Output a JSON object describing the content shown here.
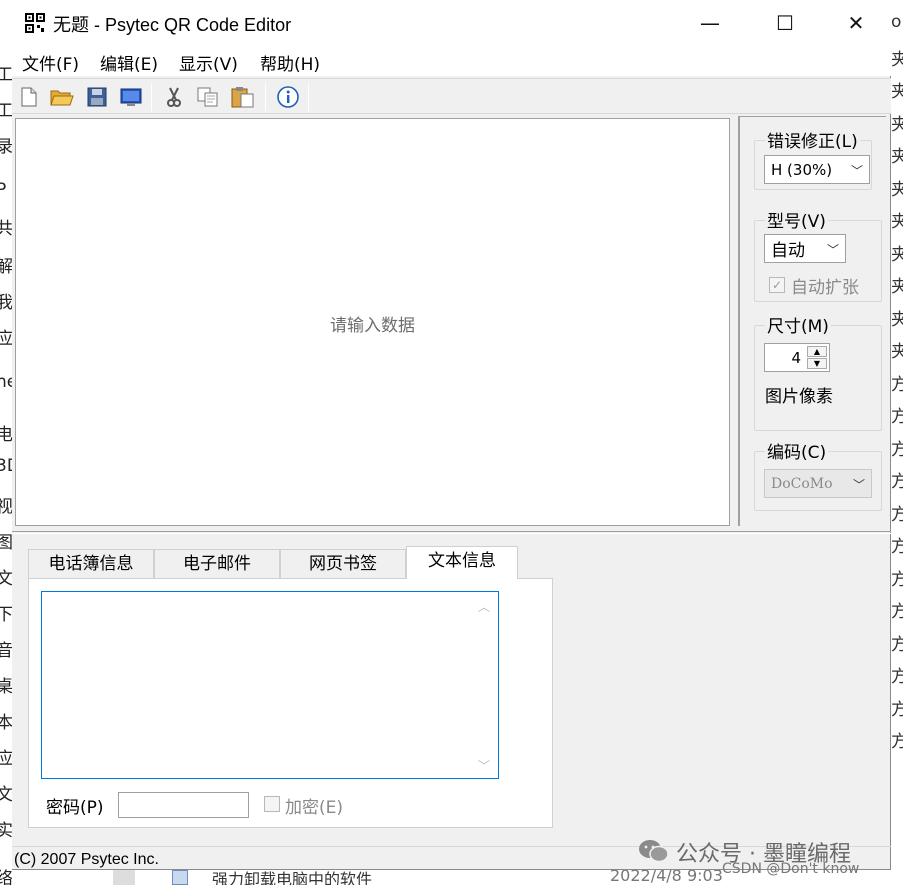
{
  "window": {
    "title": "无题 - Psytec QR Code Editor",
    "controls": {
      "minimize": "—",
      "maximize": "☐",
      "close": "✕"
    }
  },
  "menu": [
    {
      "label": "文件(F)"
    },
    {
      "label": "编辑(E)"
    },
    {
      "label": "显示(V)"
    },
    {
      "label": "帮助(H)"
    }
  ],
  "toolbar": {
    "icons": [
      "new-file-icon",
      "open-folder-icon",
      "save-disk-icon",
      "preview-monitor-icon",
      "cut-scissors-icon",
      "copy-icon",
      "paste-clipboard-icon",
      "info-icon"
    ]
  },
  "canvas": {
    "placeholder": "请输入数据"
  },
  "side": {
    "error_correction": {
      "label": "错误修正(L)",
      "value": "H (30%)"
    },
    "version": {
      "label": "型号(V)",
      "value": "自动",
      "auto_expand_label": "自动扩张",
      "auto_expand_checked": true
    },
    "size": {
      "label": "尺寸(M)",
      "value": "4",
      "unit": "图片像素"
    },
    "encoding": {
      "label": "编码(C)",
      "value": "DoCoMo"
    }
  },
  "tabs": [
    {
      "label": "电话簿信息",
      "active": false
    },
    {
      "label": "电子邮件",
      "active": false
    },
    {
      "label": "网页书签",
      "active": false
    },
    {
      "label": "文本信息",
      "active": true
    }
  ],
  "text_panel": {
    "password_label": "密码(P)",
    "password_value": "",
    "encrypt_label": "加密(E)",
    "encrypt_checked": false
  },
  "status": {
    "text": "(C) 2007 Psytec Inc."
  },
  "watermark": {
    "text": "公众号 · 墨瞳编程",
    "sub": "CSDN @Don't know"
  },
  "background": {
    "left_chars": [
      "工",
      "工",
      "录",
      "P",
      "共",
      "解",
      "我",
      "应",
      "ne",
      "电",
      "3D",
      "视",
      "图",
      "文",
      "下",
      "音",
      "桌",
      "本",
      "应",
      "文",
      "实",
      "络"
    ],
    "right_chars": [
      "o",
      "夹",
      "夹",
      "夹",
      "夹",
      "夹",
      "夹",
      "夹",
      "夹",
      "夹",
      "夹",
      "方",
      "方",
      "方",
      "方",
      "方",
      "方",
      "方",
      "方",
      "方",
      "方",
      "方",
      "方"
    ],
    "bottom_text": "强力卸载电脑中的软件",
    "bottom_date": "2022/4/8 9:03"
  }
}
